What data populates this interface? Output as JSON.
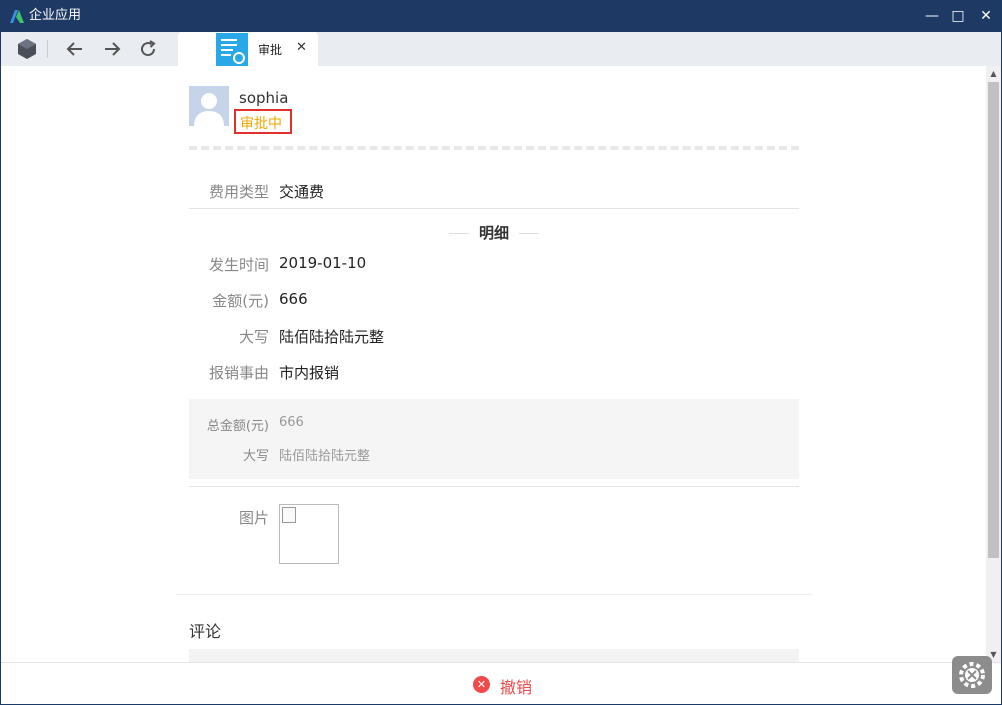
{
  "window": {
    "title": "企业应用",
    "controls": {
      "minimize": "—",
      "maximize": "□",
      "close": "✕"
    }
  },
  "toolbar": {
    "icons": [
      "app-logo-icon",
      "back-arrow-icon",
      "forward-arrow-icon",
      "refresh-icon"
    ]
  },
  "tab": {
    "label": "审批",
    "close": "✕"
  },
  "header": {
    "username": "sophia",
    "status": "审批中",
    "status_color": "#f0a800"
  },
  "form": {
    "expense_type": {
      "label": "费用类型",
      "value": "交通费"
    },
    "detail_title": "明细",
    "details": [
      {
        "label": "发生时间",
        "value": "2019-01-10"
      },
      {
        "label": "金额(元)",
        "value": "666"
      },
      {
        "label": "大写",
        "value": "陆佰陆拾陆元整"
      },
      {
        "label": "报销事由",
        "value": "市内报销"
      }
    ],
    "summary": [
      {
        "label": "总金额(元)",
        "value": "666"
      },
      {
        "label": "大写",
        "value": "陆佰陆拾陆元整"
      }
    ],
    "image_label": "图片"
  },
  "comments": {
    "label": "评论"
  },
  "footer": {
    "revoke_label": "撤销",
    "revoke_color": "#f04a4a"
  },
  "scrollbar": {
    "up": "▲",
    "down": "▼"
  }
}
